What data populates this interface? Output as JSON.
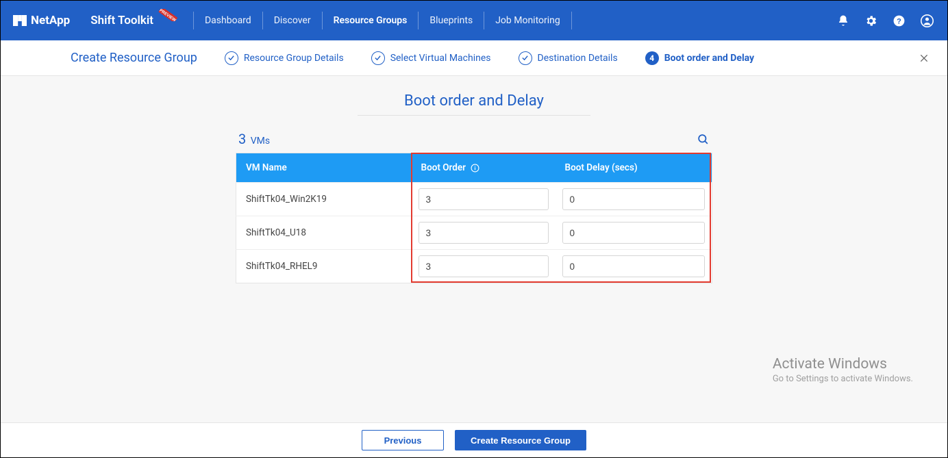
{
  "brand": {
    "name": "NetApp"
  },
  "app": {
    "title": "Shift Toolkit"
  },
  "nav": {
    "links": [
      {
        "label": "Dashboard"
      },
      {
        "label": "Discover"
      },
      {
        "label": "Resource Groups"
      },
      {
        "label": "Blueprints"
      },
      {
        "label": "Job Monitoring"
      }
    ]
  },
  "wizard": {
    "title": "Create Resource Group",
    "steps": [
      {
        "label": "Resource Group Details"
      },
      {
        "label": "Select Virtual Machines"
      },
      {
        "label": "Destination Details"
      },
      {
        "num": "4",
        "label": "Boot order and Delay"
      }
    ]
  },
  "page": {
    "heading": "Boot order and Delay",
    "vm_count_n": "3",
    "vm_count_lbl": "VMs"
  },
  "table": {
    "cols": {
      "name": "VM Name",
      "order": "Boot Order",
      "delay": "Boot Delay (secs)"
    },
    "rows": [
      {
        "name": "ShiftTk04_Win2K19",
        "order": "3",
        "delay": "0"
      },
      {
        "name": "ShiftTk04_U18",
        "order": "3",
        "delay": "0"
      },
      {
        "name": "ShiftTk04_RHEL9",
        "order": "3",
        "delay": "0"
      }
    ]
  },
  "footer": {
    "prev": "Previous",
    "create": "Create Resource Group"
  },
  "watermark": {
    "l1": "Activate Windows",
    "l2": "Go to Settings to activate Windows."
  }
}
